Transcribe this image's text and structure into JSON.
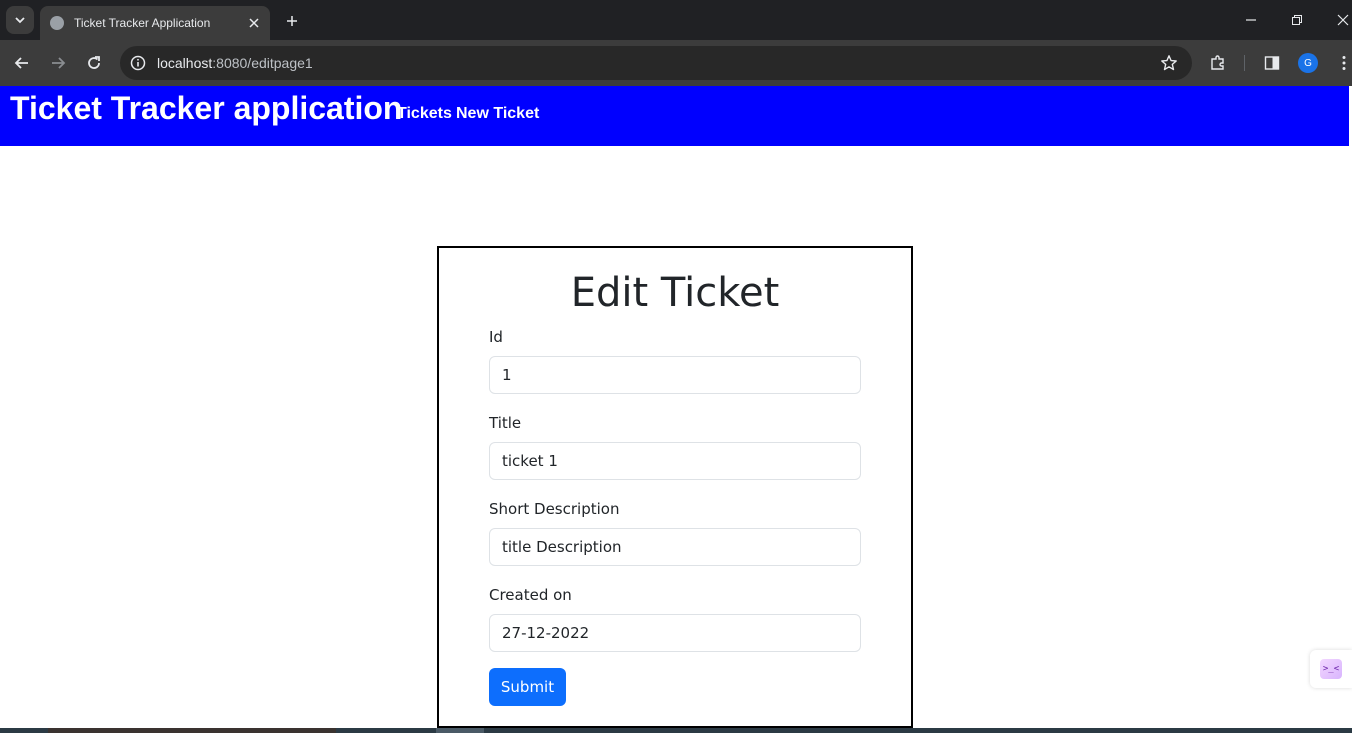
{
  "browser": {
    "tab_title": "Ticket Tracker Application",
    "url_host": "localhost",
    "url_path": ":8080/editpage1",
    "profile_initial": "G"
  },
  "navbar": {
    "brand": "Ticket Tracker application",
    "links": [
      "Tickets",
      "New Ticket"
    ],
    "background_color": "#0000ff"
  },
  "form": {
    "title": "Edit Ticket",
    "fields": [
      {
        "label": "Id",
        "value": "1"
      },
      {
        "label": "Title",
        "value": "ticket 1"
      },
      {
        "label": "Short Description",
        "value": "title Description"
      },
      {
        "label": "Created on",
        "value": "27-12-2022"
      }
    ],
    "submit_label": "Submit",
    "submit_color": "#0d6efd"
  },
  "side_widget": {
    "glyph": ">_<"
  },
  "icons": {
    "tab_search": "chevron-down-icon",
    "tab_favicon": "globe-icon",
    "tab_close": "close-icon",
    "new_tab": "plus-icon",
    "back": "arrow-left-icon",
    "forward": "arrow-right-icon",
    "reload": "reload-icon",
    "site_info": "info-icon",
    "bookmark": "star-icon",
    "extensions": "puzzle-icon",
    "side_panel": "side-panel-icon",
    "menu": "kebab-menu-icon"
  }
}
